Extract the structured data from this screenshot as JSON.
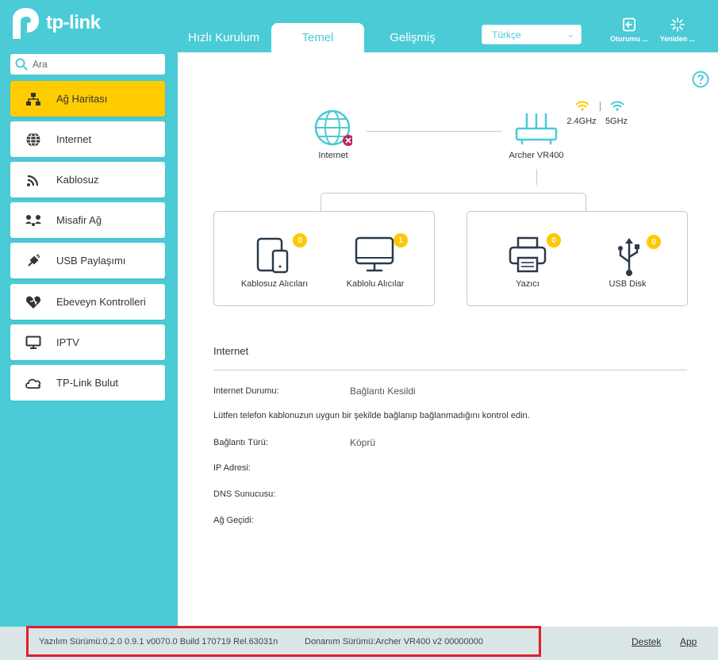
{
  "header": {
    "logo_text": "tp-link",
    "tabs": [
      {
        "label": "Hızlı Kurulum"
      },
      {
        "label": "Temel"
      },
      {
        "label": "Gelişmiş"
      }
    ],
    "language": "Türkçe",
    "logout_label": "Oturumu ...",
    "reboot_label": "Yeniden ..."
  },
  "sidebar": {
    "search_placeholder": "Ara",
    "items": [
      {
        "label": "Ağ Haritası",
        "icon": "network-map-icon",
        "active": true
      },
      {
        "label": "Internet",
        "icon": "globe-icon"
      },
      {
        "label": "Kablosuz",
        "icon": "wifi-icon"
      },
      {
        "label": "Misafir Ağ",
        "icon": "guest-network-icon"
      },
      {
        "label": "USB Paylaşımı",
        "icon": "usb-icon"
      },
      {
        "label": "Ebeveyn Kontrolleri",
        "icon": "parental-heart-icon"
      },
      {
        "label": "IPTV",
        "icon": "monitor-icon"
      },
      {
        "label": "TP-Link Bulut",
        "icon": "cloud-icon"
      }
    ]
  },
  "network_map": {
    "internet_label": "Internet",
    "internet_status": "disconnected",
    "router_label": "Archer VR400",
    "band_24": "2.4GHz",
    "band_5": "5GHz",
    "wireless_clients": {
      "label": "Kablosuz Alıcıları",
      "count": "0"
    },
    "wired_clients": {
      "label": "Kablolu Alıcılar",
      "count": "1"
    },
    "printer": {
      "label": "Yazıcı",
      "count": "0"
    },
    "usb_disk": {
      "label": "USB Disk",
      "count": "0"
    }
  },
  "internet_section": {
    "title": "Internet",
    "status_label": "Internet Durumu:",
    "status_value": "Bağlantı Kesildi",
    "hint": "Lütfen telefon kablonuzun uygun bir şekilde bağlanıp bağlanmadığını kontrol edin.",
    "conn_type_label": "Bağlantı Türü:",
    "conn_type_value": "Köprü",
    "ip_label": "IP Adresi:",
    "dns_label": "DNS Sunucusu:",
    "gateway_label": "Ağ Geçidi:"
  },
  "footer": {
    "firmware": "Yazılım Sürümü:0.2.0 0.9.1 v0070.0 Build 170719 Rel.63031n",
    "hardware": "Donanım Sürümü:Archer VR400 v2 00000000",
    "support_link": "Destek",
    "app_link": "App"
  },
  "colors": {
    "brand_teal": "#4acbd6",
    "active_yellow": "#ffcc00",
    "badge_yellow": "#ffc800",
    "error_red": "#c0245c",
    "highlight_frame": "#e0202a"
  }
}
